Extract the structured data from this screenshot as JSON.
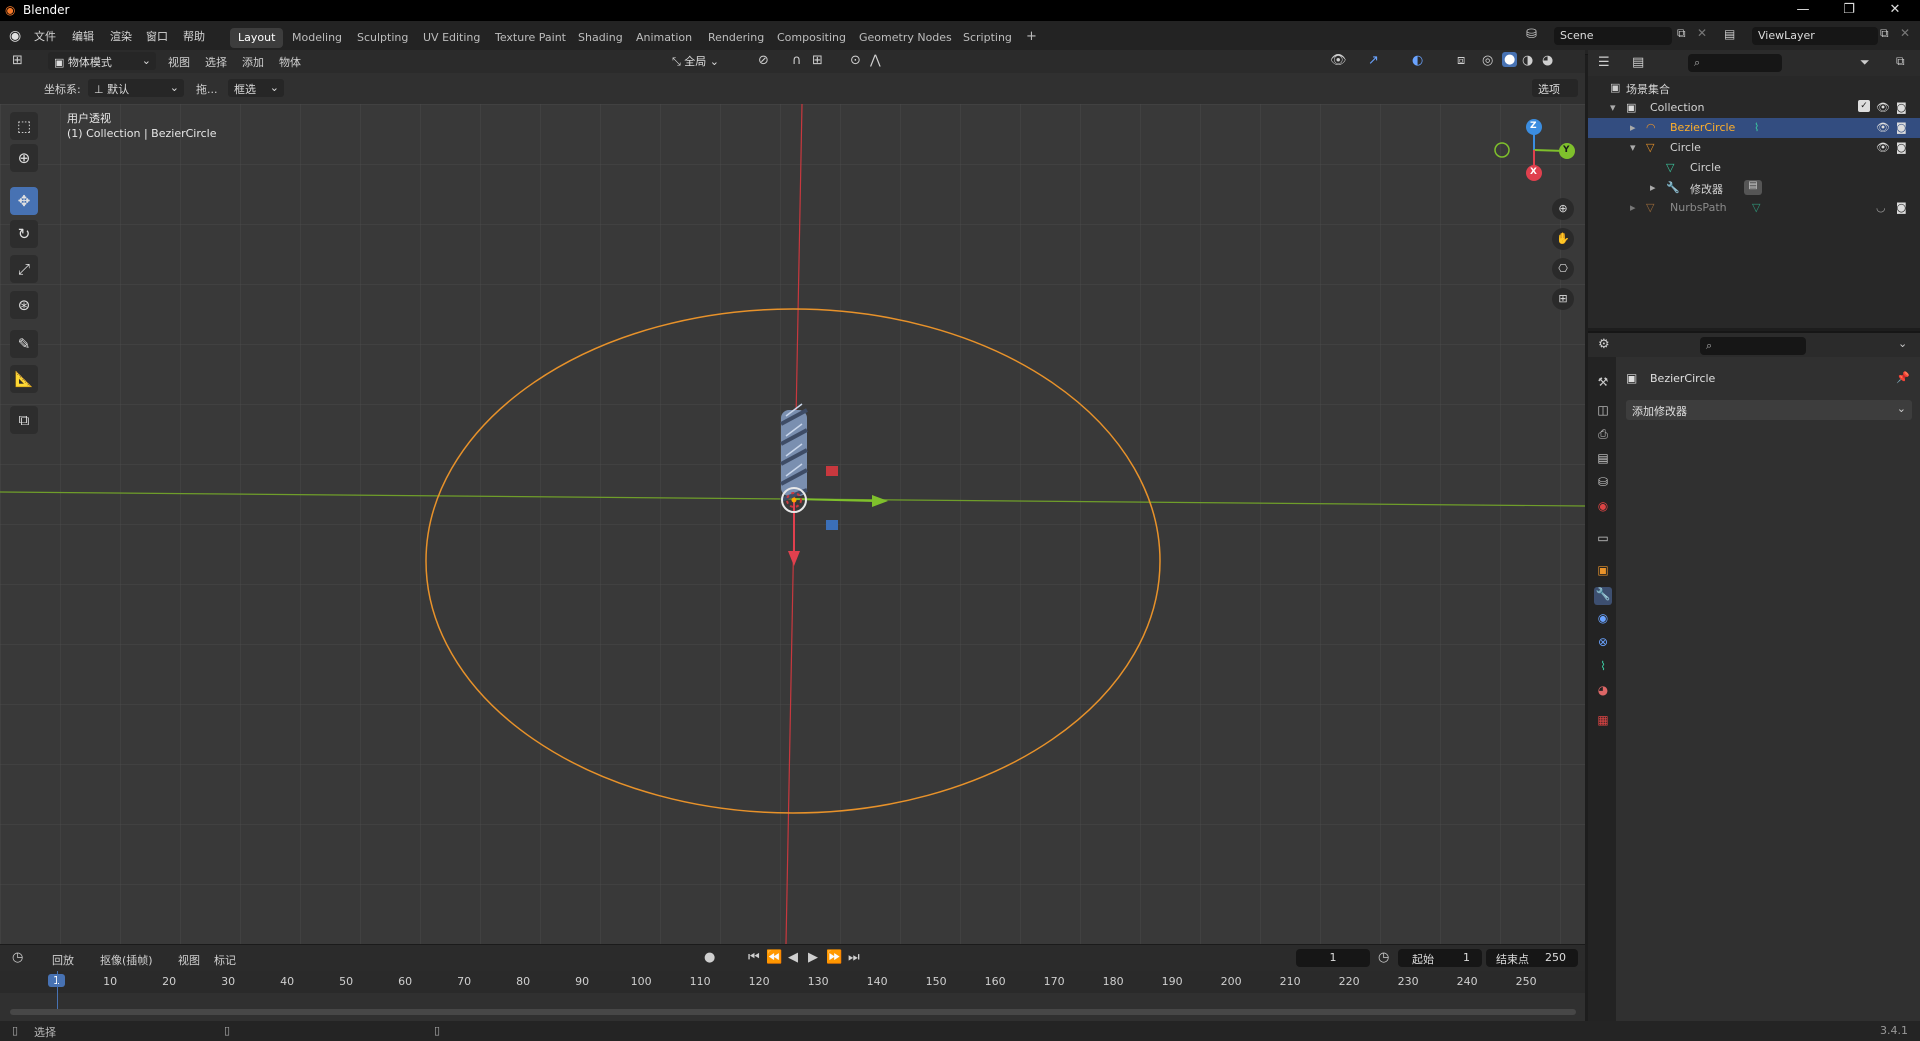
{
  "app": {
    "title": "Blender",
    "version": "3.4.1",
    "window_buttons": [
      "—",
      "❐",
      "✕"
    ]
  },
  "menu": {
    "items": [
      "文件",
      "编辑",
      "渲染",
      "窗口",
      "帮助"
    ]
  },
  "workspaces": {
    "tabs": [
      "Layout",
      "Modeling",
      "Sculpting",
      "UV Editing",
      "Texture Paint",
      "Shading",
      "Animation",
      "Rendering",
      "Compositing",
      "Geometry Nodes",
      "Scripting"
    ],
    "active": "Layout",
    "add": "+"
  },
  "scene": {
    "name": "Scene",
    "view_layer": "ViewLayer"
  },
  "viewport_header": {
    "mode": "物体模式",
    "menus": [
      "视图",
      "选择",
      "添加",
      "物体"
    ],
    "orientation_label": "全局"
  },
  "tool_settings": {
    "coord_label": "坐标系:",
    "coord_value": "默认",
    "drag_label": "拖...",
    "drag_value": "框选",
    "options": "选项"
  },
  "viewport": {
    "view_name": "用户透视",
    "context": "(1) Collection | BezierCircle",
    "gizmo": {
      "x": "X",
      "y": "Y",
      "z": "Z"
    }
  },
  "timeline": {
    "menus": [
      "回放",
      "抠像(插帧)",
      "视图",
      "标记"
    ],
    "current_frame": "1",
    "start_label": "起始",
    "start": "1",
    "end_label": "结束点",
    "end": "250",
    "ruler": [
      "1",
      "10",
      "20",
      "30",
      "40",
      "50",
      "60",
      "70",
      "80",
      "90",
      "100",
      "110",
      "120",
      "130",
      "140",
      "150",
      "160",
      "170",
      "180",
      "190",
      "200",
      "210",
      "220",
      "230",
      "240",
      "250"
    ]
  },
  "outliner": {
    "scene_collection": "场景集合",
    "rows": [
      {
        "name": "Collection",
        "level": 1,
        "arrow": "▾",
        "icon": "collection-icon"
      },
      {
        "name": "BezierCircle",
        "level": 2,
        "arrow": "▸",
        "icon": "curve-icon",
        "selected": true
      },
      {
        "name": "Circle",
        "level": 2,
        "arrow": "▾",
        "icon": "mesh-icon"
      },
      {
        "name": "Circle",
        "level": 3,
        "arrow": "",
        "icon": "mesh-data-icon"
      },
      {
        "name": "修改器",
        "level": 3,
        "arrow": "▸",
        "icon": "wrench-icon"
      },
      {
        "name": "NurbsPath",
        "level": 2,
        "arrow": "▸",
        "icon": "curve-icon",
        "dim": true
      }
    ]
  },
  "properties": {
    "object_name": "BezierCircle",
    "add_modifier": "添加修改器"
  },
  "statusbar": {
    "left": "选择"
  },
  "colors": {
    "accent": "#4772b3",
    "selected_text": "#ffaf29",
    "curve_orange": "#e8922a",
    "x_axis": "#e0404e",
    "y_axis": "#7fc02c",
    "z_axis": "#3b8de0"
  }
}
